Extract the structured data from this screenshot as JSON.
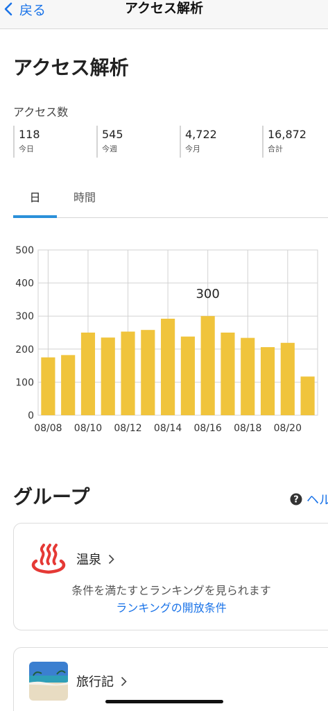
{
  "nav": {
    "back_label": "戻る",
    "title": "アクセス解析"
  },
  "page": {
    "title": "アクセス解析",
    "stats_label": "アクセス数"
  },
  "stats": [
    {
      "value": "118",
      "label": "今日"
    },
    {
      "value": "545",
      "label": "今週"
    },
    {
      "value": "4,722",
      "label": "今月"
    },
    {
      "value": "16,872",
      "label": "合計"
    }
  ],
  "tabs": [
    {
      "label": "日",
      "active": true
    },
    {
      "label": "時間",
      "active": false
    }
  ],
  "chart_data": {
    "type": "bar",
    "categories": [
      "08/08",
      "08/09",
      "08/10",
      "08/11",
      "08/12",
      "08/13",
      "08/14",
      "08/15",
      "08/16",
      "08/17",
      "08/18",
      "08/19",
      "08/20",
      "08/21"
    ],
    "x_tick_labels": [
      "08/08",
      "08/10",
      "08/12",
      "08/14",
      "08/16",
      "08/18",
      "08/20"
    ],
    "values": [
      175,
      182,
      250,
      235,
      253,
      258,
      292,
      238,
      300,
      250,
      234,
      206,
      219,
      117
    ],
    "ylim": [
      0,
      500
    ],
    "y_ticks": [
      0,
      100,
      200,
      300,
      400,
      500
    ],
    "grid": true,
    "bar_color": "#f0c43c",
    "annotation": {
      "category": "08/16",
      "text": "300"
    }
  },
  "group": {
    "title": "グループ",
    "help_label": "ヘル",
    "cards": [
      {
        "name": "温泉",
        "icon": "onsen-icon",
        "description": "条件を満たすとランキングを見られます",
        "link": "ランキングの開放条件"
      },
      {
        "name": "旅行記",
        "icon": "beach-photo-thumbnail"
      }
    ]
  },
  "colors": {
    "accent": "#1a73e8",
    "tab_underline": "#2b90d9",
    "onsen_red": "#e53935",
    "bar": "#f0c43c"
  }
}
